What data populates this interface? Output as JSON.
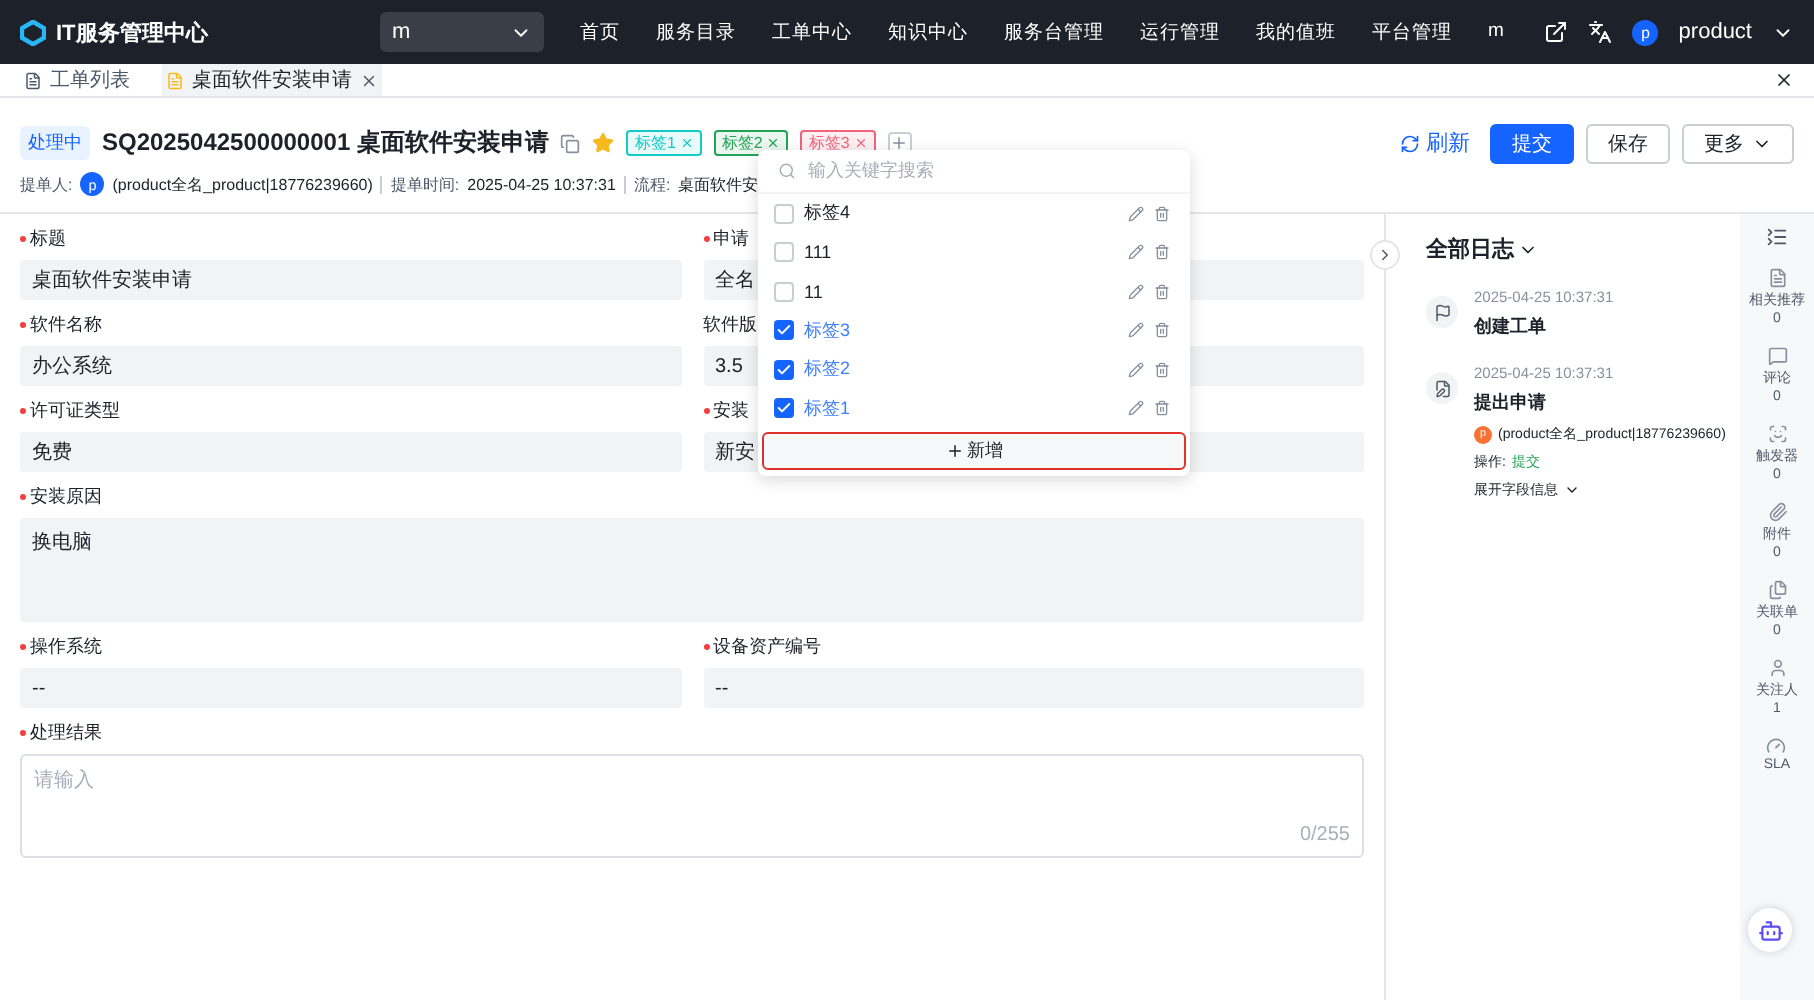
{
  "nav": {
    "logo": "IT服务管理中心",
    "workspace": "m",
    "menu": [
      {
        "label": "首页",
        "selected": false
      },
      {
        "label": "服务目录",
        "selected": false
      },
      {
        "label": "工单中心",
        "selected": false
      },
      {
        "label": "知识中心",
        "selected": false
      },
      {
        "label": "服务台管理",
        "selected": false
      },
      {
        "label": "运行管理",
        "selected": false
      },
      {
        "label": "我的值班",
        "selected": false
      },
      {
        "label": "平台管理",
        "selected": false
      },
      {
        "label": "m",
        "selected": false
      }
    ],
    "avatar": "p",
    "user": "product"
  },
  "tabs": [
    {
      "label": "工单列表",
      "selected": false
    },
    {
      "label": "桌面软件安装申请",
      "selected": true
    }
  ],
  "header": {
    "status": "处理中",
    "title": "SQ2025042500000001 桌面软件安装申请",
    "starred": true,
    "tags": [
      {
        "label": "标签1",
        "color": "#14c9c9"
      },
      {
        "label": "标签2",
        "color": "#23a455"
      },
      {
        "label": "标签3",
        "color": "#f0647a"
      }
    ],
    "refresh": "刷新",
    "submit": "提交",
    "save": "保存",
    "more": "更多"
  },
  "meta": {
    "submitter_label": "提单人:",
    "avatar": "p",
    "submitter": "(product全名_product|18776239660)",
    "time_label": "提单时间:",
    "time": "2025-04-25 10:37:31",
    "flow_label": "流程:",
    "flow": "桌面软件安"
  },
  "fields": [
    {
      "kind": "input",
      "label": "标题",
      "required": true,
      "value": "桌面软件安装申请"
    },
    {
      "kind": "input",
      "label": "申请",
      "required": true,
      "value": "全名"
    },
    {
      "kind": "input",
      "label": "软件名称",
      "required": true,
      "value": "办公系统"
    },
    {
      "kind": "input",
      "label": "软件版",
      "required": false,
      "value": "3.5"
    },
    {
      "kind": "input",
      "label": "许可证类型",
      "required": true,
      "value": "免费"
    },
    {
      "kind": "input",
      "label": "安装",
      "required": true,
      "value": "新安"
    },
    {
      "kind": "textarea",
      "label": "安装原因",
      "required": true,
      "value": "换电脑"
    },
    {
      "kind": "input",
      "label": "操作系统",
      "required": true,
      "value": "--"
    },
    {
      "kind": "input",
      "label": "设备资产编号",
      "required": true,
      "value": "--"
    },
    {
      "kind": "editor",
      "label": "处理结果",
      "required": true,
      "placeholder": "请输入",
      "counter": "0/255"
    }
  ],
  "tag_dropdown": {
    "placeholder": "输入关键字搜索",
    "items": [
      {
        "label": "标签4",
        "checked": false
      },
      {
        "label": "111",
        "checked": false
      },
      {
        "label": "11",
        "checked": false
      },
      {
        "label": "标签3",
        "checked": true
      },
      {
        "label": "标签2",
        "checked": true
      },
      {
        "label": "标签1",
        "checked": true
      }
    ],
    "add": "新增"
  },
  "log": {
    "title": "全部日志",
    "entries": [
      {
        "time": "2025-04-25 10:37:31",
        "title": "创建工单"
      },
      {
        "time": "2025-04-25 10:37:31",
        "title": "提出申请",
        "avatar": "p",
        "user": "(product全名_product|18776239660)",
        "action_label": "操作:",
        "action": "提交",
        "expand": "展开字段信息"
      }
    ]
  },
  "rail": [
    {
      "label": "相关推荐",
      "count": "0"
    },
    {
      "label": "评论",
      "count": "0"
    },
    {
      "label": "触发器",
      "count": "0"
    },
    {
      "label": "附件",
      "count": "0"
    },
    {
      "label": "关联单",
      "count": "0"
    },
    {
      "label": "关注人",
      "count": "1"
    },
    {
      "label": "SLA"
    }
  ]
}
